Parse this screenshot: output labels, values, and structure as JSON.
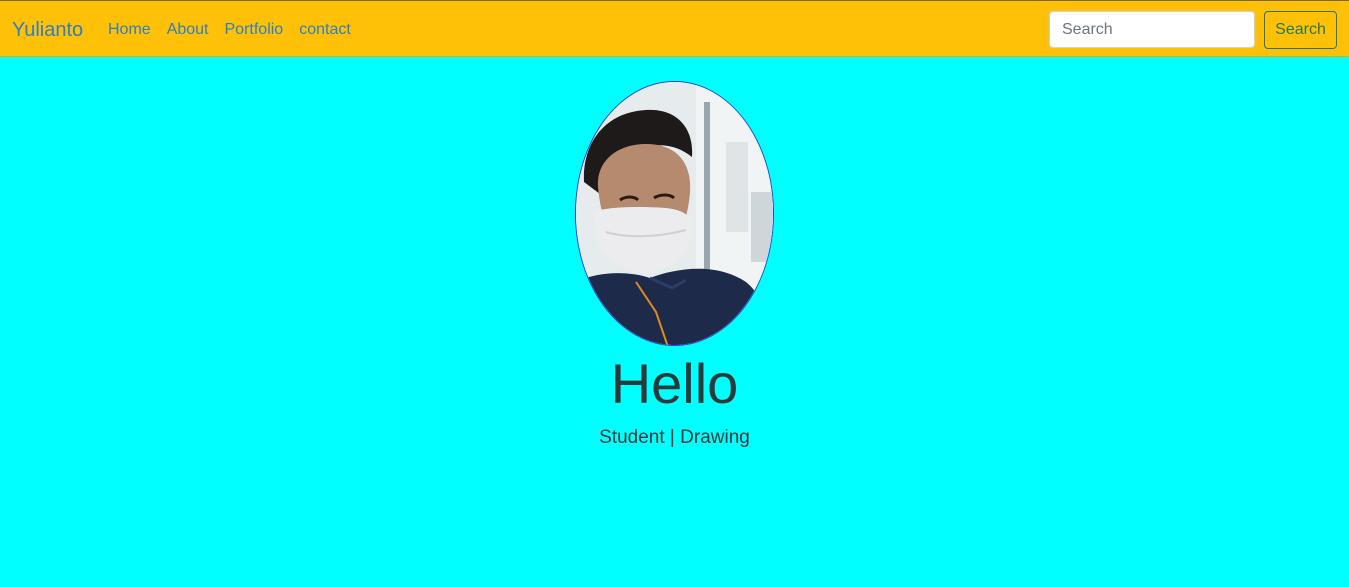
{
  "navbar": {
    "brand": "Yulianto",
    "links": [
      {
        "label": "Home"
      },
      {
        "label": "About"
      },
      {
        "label": "Portfolio"
      },
      {
        "label": "contact"
      }
    ],
    "search_placeholder": "Search",
    "search_value": "",
    "search_button_label": "Search"
  },
  "hero": {
    "avatar_alt": "profile-photo",
    "title": "Hello",
    "subtitle": "Student | Drawing"
  },
  "colors": {
    "navbar_bg": "#ffc107",
    "page_bg": "#00ffff",
    "link": "#2f7fc0",
    "search_button": "#28783a"
  }
}
